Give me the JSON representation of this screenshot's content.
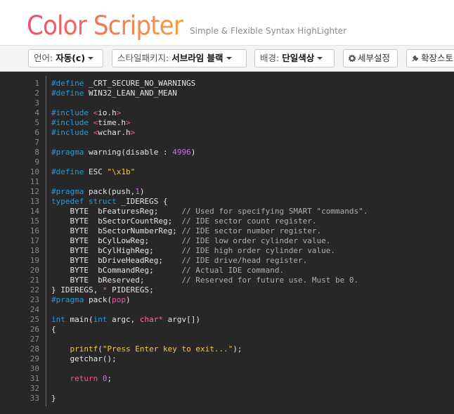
{
  "header": {
    "logo_text": "Color Scripter",
    "tagline": "Simple & Flexible Syntax HighLighter"
  },
  "toolbar": {
    "language": {
      "label": "언어:",
      "value": "자동(c)"
    },
    "style_package": {
      "label": "스타일패키지:",
      "value": "서브라임 블랙"
    },
    "background": {
      "label": "배경:",
      "value": "단일색상"
    },
    "detail_settings": "세부설정",
    "extension_store": "확장스토"
  },
  "colors": {
    "logo_gradient": [
      "#f04e6e",
      "#f6a043"
    ],
    "editor_bg": "#272727",
    "preprocessor": "#2a9bd6",
    "string": "#f6c94a",
    "number": "#d06af0",
    "comment": "#b0b0b0"
  },
  "code_lines": [
    [
      {
        "t": "#define",
        "c": "pp"
      },
      {
        "t": " _CRT_SECURE_NO_WARNINGS"
      }
    ],
    [
      {
        "t": "#define",
        "c": "pp"
      },
      {
        "t": " WIN32_LEAN_AND_MEAN"
      }
    ],
    [],
    [
      {
        "t": "#include",
        "c": "pp"
      },
      {
        "t": " "
      },
      {
        "t": "<",
        "c": "inc"
      },
      {
        "t": "io.h"
      },
      {
        "t": ">",
        "c": "inc"
      }
    ],
    [
      {
        "t": "#include",
        "c": "pp"
      },
      {
        "t": " "
      },
      {
        "t": "<",
        "c": "inc"
      },
      {
        "t": "time.h"
      },
      {
        "t": ">",
        "c": "inc"
      }
    ],
    [
      {
        "t": "#include",
        "c": "pp"
      },
      {
        "t": " "
      },
      {
        "t": "<",
        "c": "inc"
      },
      {
        "t": "wchar.h"
      },
      {
        "t": ">",
        "c": "inc"
      }
    ],
    [],
    [
      {
        "t": "#pragma",
        "c": "pp"
      },
      {
        "t": " warning(disable : "
      },
      {
        "t": "4996",
        "c": "num"
      },
      {
        "t": ")"
      }
    ],
    [],
    [
      {
        "t": "#define",
        "c": "pp"
      },
      {
        "t": " ESC "
      },
      {
        "t": "\"\\x1b\"",
        "c": "str"
      }
    ],
    [],
    [
      {
        "t": "#pragma",
        "c": "pp"
      },
      {
        "t": " pack(push,"
      },
      {
        "t": "1",
        "c": "num"
      },
      {
        "t": ")"
      }
    ],
    [
      {
        "t": "typedef",
        "c": "kw"
      },
      {
        "t": " "
      },
      {
        "t": "struct",
        "c": "kw"
      },
      {
        "t": " _IDEREGS {"
      }
    ],
    [
      {
        "t": "    BYTE  bFeaturesReg;     "
      },
      {
        "t": "// Used for specifying SMART \"commands\".",
        "c": "cm"
      }
    ],
    [
      {
        "t": "    BYTE  bSectorCountReg;  "
      },
      {
        "t": "// IDE sector count register.",
        "c": "cm"
      }
    ],
    [
      {
        "t": "    BYTE  bSectorNumberReg; "
      },
      {
        "t": "// IDE sector number register.",
        "c": "cm"
      }
    ],
    [
      {
        "t": "    BYTE  bCylLowReg;       "
      },
      {
        "t": "// IDE low order cylinder value.",
        "c": "cm"
      }
    ],
    [
      {
        "t": "    BYTE  bCylHighReg;      "
      },
      {
        "t": "// IDE high order cylinder value.",
        "c": "cm"
      }
    ],
    [
      {
        "t": "    BYTE  bDriveHeadReg;    "
      },
      {
        "t": "// IDE drive/head register.",
        "c": "cm"
      }
    ],
    [
      {
        "t": "    BYTE  bCommandReg;      "
      },
      {
        "t": "// Actual IDE command.",
        "c": "cm"
      }
    ],
    [
      {
        "t": "    BYTE  bReserved;        "
      },
      {
        "t": "// Reserved for future use. Must be 0.",
        "c": "cm"
      }
    ],
    [
      {
        "t": "} IDEREGS, "
      },
      {
        "t": "*",
        "c": "inc"
      },
      {
        "t": " PIDEREGS;"
      }
    ],
    [
      {
        "t": "#pragma",
        "c": "pp"
      },
      {
        "t": " pack("
      },
      {
        "t": "pop",
        "c": "inc"
      },
      {
        "t": ")"
      }
    ],
    [],
    [
      {
        "t": "int",
        "c": "kw"
      },
      {
        "t": " main("
      },
      {
        "t": "int",
        "c": "kw"
      },
      {
        "t": " argc, "
      },
      {
        "t": "char",
        "c": "ty"
      },
      {
        "t": "*",
        "c": "inc"
      },
      {
        "t": " argv[])"
      }
    ],
    [
      {
        "t": "{"
      }
    ],
    [],
    [
      {
        "t": "    "
      },
      {
        "t": "printf",
        "c": "fn"
      },
      {
        "t": "("
      },
      {
        "t": "\"Press Enter key to exit...\"",
        "c": "str"
      },
      {
        "t": ");"
      }
    ],
    [
      {
        "t": "    getchar();"
      }
    ],
    [],
    [
      {
        "t": "    "
      },
      {
        "t": "return",
        "c": "inc"
      },
      {
        "t": " "
      },
      {
        "t": "0",
        "c": "num"
      },
      {
        "t": ";"
      }
    ],
    [],
    [
      {
        "t": "}"
      }
    ]
  ]
}
